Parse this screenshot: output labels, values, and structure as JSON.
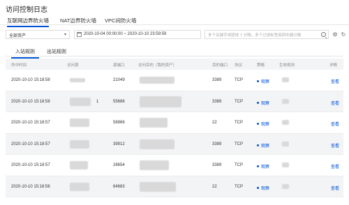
{
  "page": {
    "title": "访问控制日志"
  },
  "tabs": [
    {
      "label": "互联网边界防火墙",
      "active": true
    },
    {
      "label": "NAT边界防火墙",
      "active": false
    },
    {
      "label": "VPC间防火墙",
      "active": false
    }
  ],
  "toolbar": {
    "asset_select": "全部资产",
    "date_range": "2020-10-04 00:00:00 ~ 2020-10-10 23:59:59",
    "search_placeholder": "多个关键字用竖线 '|' 分隔，多个过滤标签用回车键分隔"
  },
  "subtabs": [
    {
      "label": "入站规则",
      "active": true
    },
    {
      "label": "出站规则",
      "active": false
    }
  ],
  "table": {
    "headers": [
      "命中时间",
      "访问源",
      "源端口",
      "访问目的（我的资产）",
      "目的端口",
      "协议",
      "策略",
      "生效规则",
      "详情"
    ],
    "rows": [
      {
        "time": "2020-10-10 15:18:58",
        "src_port": "21049",
        "dst_port": "3389",
        "proto": "TCP",
        "policy": "观察",
        "detail": "查看"
      },
      {
        "time": "2020-10-10 15:18:58",
        "src_port": "55686",
        "dst_port": "3389",
        "proto": "TCP",
        "policy": "观察",
        "detail": "查看",
        "extra": "1"
      },
      {
        "time": "2020-10-10 15:18:57",
        "src_port": "58966",
        "dst_port": "22",
        "proto": "TCP",
        "policy": "观察",
        "detail": "查看"
      },
      {
        "time": "2020-10-10 15:18:57",
        "src_port": "39912",
        "dst_port": "3389",
        "proto": "TCP",
        "policy": "观察",
        "detail": "查看"
      },
      {
        "time": "2020-10-10 15:18:57",
        "src_port": "28654",
        "dst_port": "3389",
        "proto": "TCP",
        "policy": "观察",
        "detail": "查看"
      },
      {
        "time": "2020-10-10 15:18:56",
        "src_port": "64683",
        "dst_port": "22",
        "proto": "TCP",
        "policy": "观察",
        "detail": "查看"
      }
    ]
  },
  "colors": {
    "accent": "#0052d9",
    "header_bg": "#f3f4f6",
    "border": "#e6e6e6"
  }
}
